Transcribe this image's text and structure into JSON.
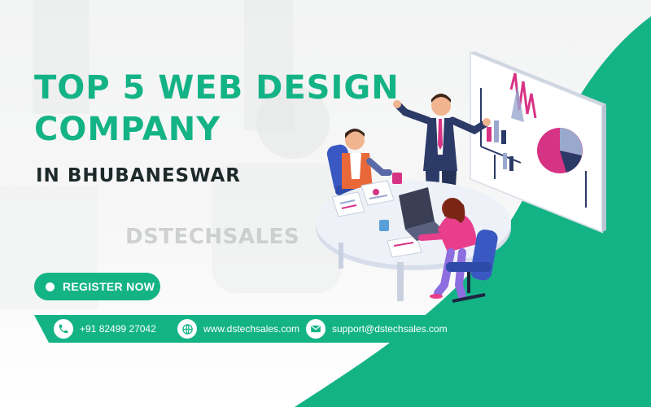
{
  "banner": {
    "title_line1": "TOP 5 WEB DESIGN",
    "title_line2": "COMPANY",
    "subtitle": "IN BHUBANESWAR",
    "watermark": "DSTECHSALES",
    "register_label": "REGISTER NOW"
  },
  "contacts": [
    {
      "icon": "phone-icon",
      "text": "+91 82499 27042"
    },
    {
      "icon": "globe-icon",
      "text": "www.dstechsales.com"
    },
    {
      "icon": "mail-icon",
      "text": "support@dstechsales.com"
    }
  ],
  "colors": {
    "accent": "#14b386",
    "title_dark": "#1e2a2a",
    "background": "#f4f5f5"
  }
}
